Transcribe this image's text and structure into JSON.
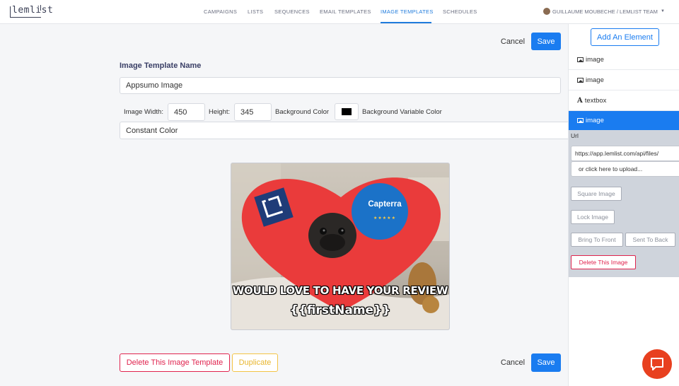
{
  "brand": {
    "logo_text": "lemlist",
    "accent": "#1a7cf0"
  },
  "nav": {
    "items": [
      {
        "label": "CAMPAIGNS"
      },
      {
        "label": "LISTS"
      },
      {
        "label": "SEQUENCES"
      },
      {
        "label": "EMAIL TEMPLATES"
      },
      {
        "label": "IMAGE TEMPLATES",
        "active": true
      },
      {
        "label": "SCHEDULES"
      }
    ],
    "user_label": "GUILLAUME MOUBECHE / LEMLIST TEAM"
  },
  "toolbar": {
    "cancel_label": "Cancel",
    "save_label": "Save"
  },
  "form": {
    "section_title": "Image Template Name",
    "name_value": "Appsumo Image",
    "width_label": "Image Width:",
    "width_value": "450",
    "height_label": "Height:",
    "height_value": "345",
    "bg_color_label": "Background Color",
    "bg_color_value": "#000000",
    "bg_variable_label": "Background Variable Color",
    "bg_variable_value": "Constant Color"
  },
  "preview": {
    "line1": "WOULD LOVE TO HAVE YOUR REVIEW",
    "line2": "{{firstName}}",
    "badge_text": "Capterra",
    "badge_stars": "★★★★★"
  },
  "footer": {
    "delete_label": "Delete This Image Template",
    "duplicate_label": "Duplicate",
    "cancel_label": "Cancel",
    "save_label": "Save"
  },
  "sidebar": {
    "add_label": "Add An Element",
    "elements": [
      {
        "type": "image",
        "label": "image"
      },
      {
        "type": "image",
        "label": "image"
      },
      {
        "type": "textbox",
        "label": "textbox"
      },
      {
        "type": "image",
        "label": "image",
        "active": true
      }
    ],
    "props": {
      "url_label": "Url",
      "url_value": "https://app.lemlist.com/api/files/",
      "upload_label": "or click here to upload...",
      "square_label": "Square Image",
      "lock_label": "Lock Image",
      "front_label": "Bring To Front",
      "back_label": "Sent To Back",
      "delete_label": "Delete This Image"
    }
  },
  "chat": {
    "icon": "chat-bubble-icon",
    "color": "#e8401f"
  }
}
